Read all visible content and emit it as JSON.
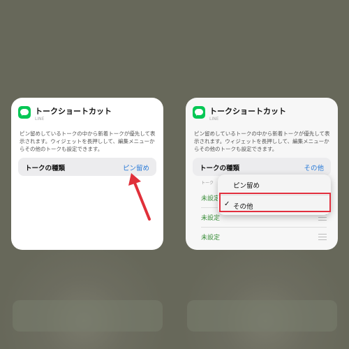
{
  "left_widget": {
    "title": "トークショートカット",
    "app_name": "LINE",
    "description": "ピン留めしているトークの中から新着トークが優先して表示されます。ウィジェットを長押しして、編集メニューからその他のトークも設定できます。",
    "setting": {
      "label": "トークの種類",
      "value": "ピン留め"
    }
  },
  "right_widget": {
    "title": "トークショートカット",
    "app_name": "LINE",
    "description": "ピン留めしているトークの中から新着トークが優先して表示されます。ウィジェットを長押しして、編集メニューからその他のトークも設定できます。",
    "setting": {
      "label": "トークの種類",
      "value": "その他"
    },
    "section_label": "トーク",
    "rows": [
      "未設定",
      "未設定",
      "未設定"
    ],
    "menu": {
      "options": [
        "ピン留め",
        "その他"
      ],
      "selected_index": 1,
      "check_mark": "✓"
    }
  },
  "colors": {
    "accent_blue": "#2a7bd8",
    "line_green": "#06c755",
    "highlight_red": "#e2303f",
    "arrow_red": "#e0303a"
  }
}
